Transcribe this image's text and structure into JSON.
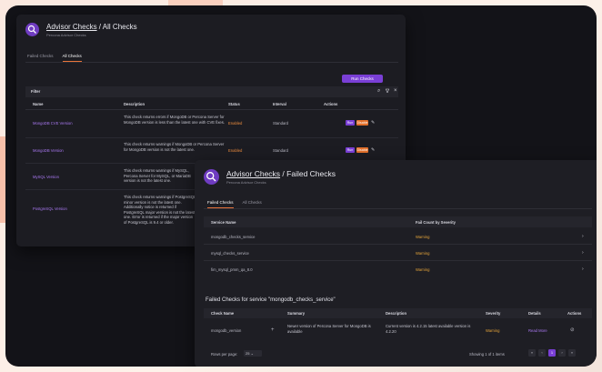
{
  "colors": {
    "accent": "#7a3fd6",
    "link": "#a878f0",
    "status_enabled": "#ee8d3e",
    "warning": "#e5a43a",
    "tab_underline": "#e9743a",
    "disable_button": "#e3702b"
  },
  "all_checks": {
    "title_link": "Advisor Checks",
    "title_rest": " / All Checks",
    "subtitle": "Percona Advisor Checks",
    "tabs": [
      "Failed Checks",
      "All Checks"
    ],
    "active_tab": "All Checks",
    "run_button": "Run Checks",
    "filter_label": "Filter",
    "columns": [
      "Name",
      "Description",
      "Status",
      "Interval",
      "Actions"
    ],
    "rows": [
      {
        "name": "MongoDB CVE Version",
        "description": "This check returns errors if MongoDB or Percona Server for MongoDB version is less than the latest one with CVE fixes.",
        "status": "Enabled",
        "interval": "Standard",
        "run": "Run",
        "toggle": "Disable"
      },
      {
        "name": "MongoDB Version",
        "description": "This check returns warnings if MongoDB or Percona Server for MongoDB version is not the latest one.",
        "status": "Enabled",
        "interval": "Standard",
        "run": "Run",
        "toggle": "Disable"
      },
      {
        "name": "MySQL Version",
        "description": "This check returns warnings if MySQL, Percona Server for MySQL, or MariaDB version is not the latest one."
      },
      {
        "name": "PostgreSQL Version",
        "description": "This check returns warnings if PostgreSQL minor version is not the latest one. Additionally notice is returned if PostgreSQL major version is not the latest one. Error is returned if the major version of PostgreSQL is 9.4 or older."
      }
    ]
  },
  "failed_checks": {
    "title_link": "Advisor Checks",
    "title_rest": " / Failed Checks",
    "subtitle": "Percona Advisor Checks",
    "tabs": [
      "Failed Checks",
      "All Checks"
    ],
    "active_tab": "Failed Checks",
    "columns": [
      "Service Name",
      "Fail Count by Severity"
    ],
    "rows": [
      {
        "service": "mongodb_checks_service",
        "count": "Warning"
      },
      {
        "service": "mysql_checks_service",
        "count": "Warning"
      },
      {
        "service": "fim_mysql_pmm_qa_8.0",
        "count": "Warning"
      }
    ],
    "detail_title": "Failed Checks for service \"mongodb_checks_service\"",
    "detail_columns": [
      "Check Name",
      "Summary",
      "Description",
      "Severity",
      "Details",
      "Actions"
    ],
    "detail_rows": [
      {
        "check": "mongodb_version",
        "summary": "Newer version of Percona Server for MongoDB is available",
        "description": "Current version is 4.2.15 latest available version is 4.2.20",
        "severity": "Warning",
        "details": "Read More"
      }
    ],
    "rows_per_page_label": "Rows per page:",
    "rows_per_page_value": "25",
    "showing": "Showing 1 of 1 items",
    "pages": [
      "«",
      "‹",
      "1",
      "›",
      "»"
    ],
    "current_page": "1"
  }
}
